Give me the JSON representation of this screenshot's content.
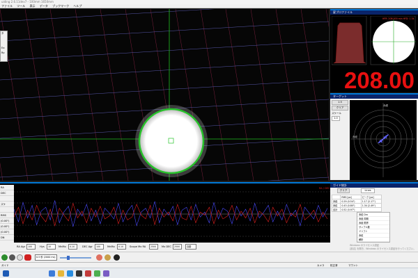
{
  "window": {
    "title": "uiding 2.6.11dev7 - 100mm 1650mm"
  },
  "menu": [
    "ファイル",
    "ツール",
    "表示",
    "データ",
    "ブックマーク",
    "ヘルプ"
  ],
  "float_panel": [
    "タ",
    "",
    "",
    "Ex:",
    "Rp"
  ],
  "profile": {
    "title": "星プロファイル",
    "hfd_value": "208.00",
    "note": "HFR: 208.000 min HFD: 1.34"
  },
  "target": {
    "title": "ターゲット",
    "zoom_label": "1:5",
    "clear_button": "クリア",
    "scale_label": "スケール",
    "scale_value": "1.0",
    "ra_axis_label": "赤経",
    "dec_axis_label": "赤緯",
    "colors": {
      "ra": "#6666ff",
      "dec": "#ff4444"
    }
  },
  "graph": {
    "side_labels": [
      "RA",
      "DEC",
      "",
      "スケ",
      "",
      "RMS",
      "(0.00\")",
      "(0.00\")",
      "(0.00\")",
      "DN"
    ],
    "legend": "RA / DEC",
    "colors": {
      "ra": "#4a4aff",
      "dec": "#e02020"
    },
    "series": [
      {
        "name": "RA",
        "values": [
          0.5,
          -0.8,
          1.2,
          -0.4,
          0.9,
          -1.1,
          0.3,
          0.7,
          -0.6,
          1.4,
          -0.9,
          0.2,
          0.8,
          -1.3,
          0.5,
          -0.2,
          1.0,
          -0.7,
          0.4,
          -1.0,
          0.6,
          0.1,
          -0.5,
          1.1,
          -0.8,
          0.3,
          0.9,
          -1.2,
          0.2,
          0.6,
          -0.4,
          1.3,
          -0.9,
          0.5,
          -0.1,
          0.8,
          -1.1,
          0.4,
          0.7,
          -0.6,
          1.0,
          -0.3,
          0.2,
          -0.9,
          1.2,
          -0.5,
          0.6,
          0.3,
          -1.0,
          0.8,
          -0.2,
          0.5,
          -0.7,
          1.1,
          -0.4,
          0.2,
          0.9,
          -0.8,
          0.3,
          -0.6,
          1.0,
          -0.2,
          0.4,
          -1.2,
          0.7,
          0.1,
          -0.5,
          0.9,
          -0.3,
          0.6
        ]
      },
      {
        "name": "DEC",
        "values": [
          -0.3,
          0.7,
          -1.0,
          0.4,
          -0.6,
          0.9,
          -0.2,
          -0.8,
          0.5,
          -1.2,
          0.6,
          -0.1,
          -0.7,
          1.1,
          -0.4,
          0.3,
          -0.9,
          0.6,
          -0.3,
          0.8,
          -0.5,
          -0.2,
          0.7,
          -1.0,
          0.4,
          -0.6,
          -0.3,
          1.0,
          -0.1,
          -0.5,
          0.9,
          -1.1,
          0.6,
          -0.3,
          0.2,
          -0.7,
          1.0,
          -0.4,
          -0.6,
          0.8,
          -0.9,
          0.2,
          -0.1,
          0.7,
          -1.0,
          0.4,
          -0.5,
          -0.2,
          0.9,
          -0.6,
          0.3,
          -0.4,
          0.6,
          -0.9,
          0.3,
          -0.1,
          -0.8,
          0.7,
          -0.2,
          0.5,
          -0.9,
          0.1,
          -0.3,
          1.0,
          -0.6,
          -0.2,
          0.4,
          -0.8,
          0.2,
          -0.5
        ]
      }
    ]
  },
  "stats": {
    "title": "ガイド統計",
    "clear_button": "クリア",
    "mode_value": "Lines",
    "table_head": [
      "RMS [px]",
      "ピーク [px]"
    ],
    "table_rows": [
      [
        "赤経",
        "0.29 (0.54\")",
        "1.17 (2.17\")"
      ],
      [
        "赤緯",
        "0.43 (0.80\")",
        "1.34 (2.49\")"
      ],
      [
        "合計",
        "0.52 (0.97\")",
        ""
      ]
    ],
    "list": [
      "赤緯 Drx",
      "赤経 周期",
      "赤経 限界",
      "サンプル数",
      "ドリフト",
      "赤緯",
      "解析"
    ],
    "watermark_line1": "Windows のライセンス認証",
    "watermark_line2": "[設定] を開き、Windows のライセンス認証を行ってください。"
  },
  "params": {
    "ra_agr_label": "RA Agr",
    "ra_agr_value": "100",
    "hys_label": "Hys",
    "hys_value": "10",
    "mnmo_label": "MnMo",
    "mnmo_value": "0.10",
    "dec_agr_label": "DEC Agr",
    "dec_agr_value": "100",
    "mnmo2_label": "MnMo",
    "mnmo2_value": "0.10",
    "scope_label": "Scope Mx RA",
    "scope_value": "2500",
    "mxdec_label": "Mx DEC",
    "mxdec_value": "2500",
    "auto_value": "自動"
  },
  "toolbar": {
    "exposure_value": "0.5 秒 (2000 ms)",
    "gain_label": "100"
  },
  "status": {
    "left": "ガイド",
    "cam_label": "カメラ",
    "cal_label": "校正済",
    "mount_label": "マウント"
  }
}
